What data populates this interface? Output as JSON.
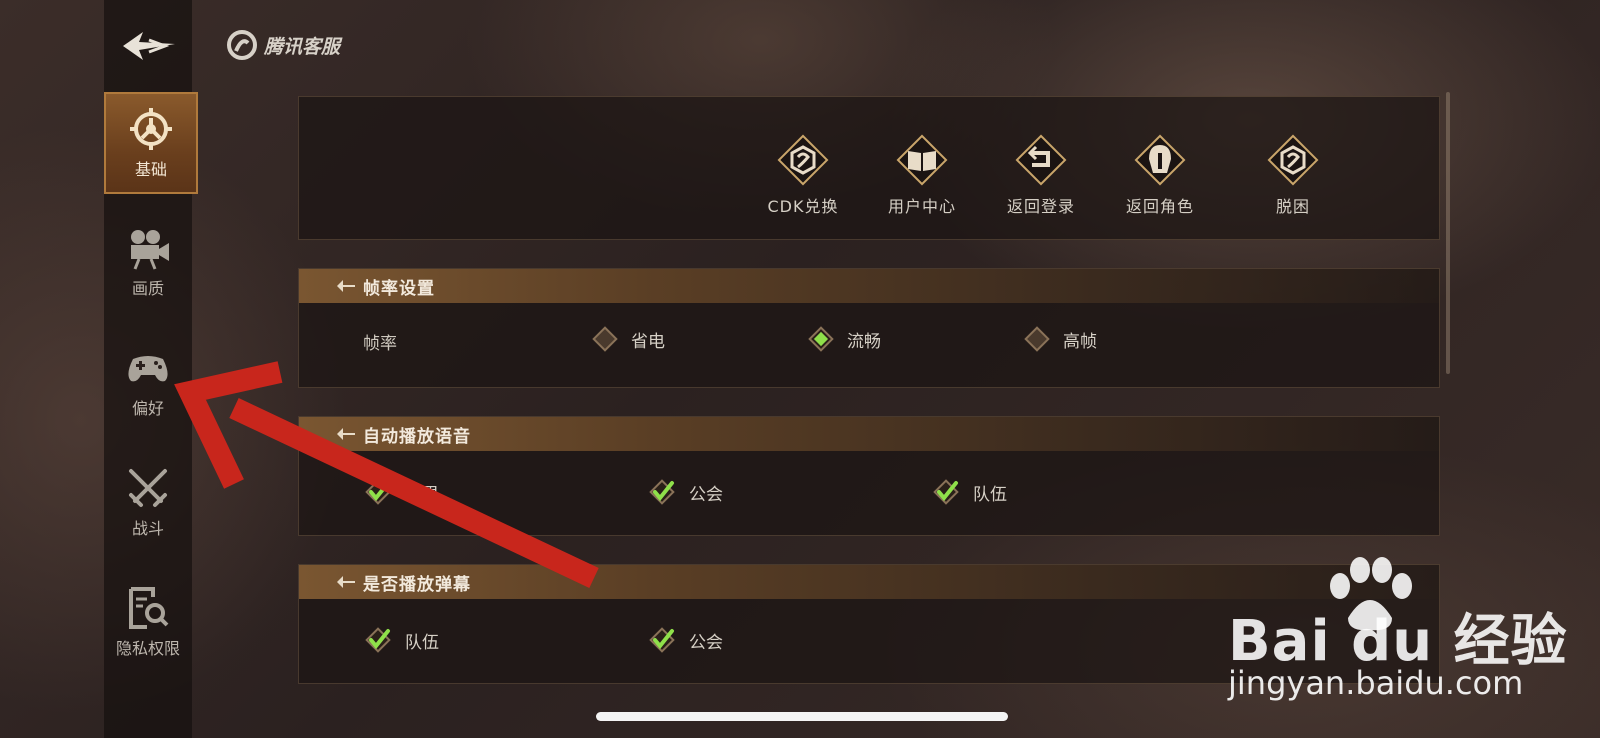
{
  "header": {
    "brand_label": "腾讯客服"
  },
  "sidebar": {
    "items": [
      {
        "label": "基础",
        "icon": "gear-wheel-icon",
        "active": true
      },
      {
        "label": "画质",
        "icon": "video-camera-icon",
        "active": false
      },
      {
        "label": "偏好",
        "icon": "gamepad-icon",
        "active": false
      },
      {
        "label": "战斗",
        "icon": "crossed-swords-icon",
        "active": false
      },
      {
        "label": "隐私权限",
        "icon": "privacy-search-icon",
        "active": false
      }
    ]
  },
  "shortcuts": [
    {
      "label": "CDK兑换",
      "icon": "cdk-badge-icon"
    },
    {
      "label": "用户中心",
      "icon": "book-icon"
    },
    {
      "label": "返回登录",
      "icon": "return-arrow-icon"
    },
    {
      "label": "返回角色",
      "icon": "helmet-icon"
    },
    {
      "label": "脱困",
      "icon": "escape-badge-icon"
    }
  ],
  "framerate": {
    "title": "帧率设置",
    "row_label": "帧率",
    "options": [
      {
        "label": "省电",
        "selected": false
      },
      {
        "label": "流畅",
        "selected": true
      },
      {
        "label": "高帧",
        "selected": false
      }
    ]
  },
  "auto_voice": {
    "title": "自动播放语音",
    "options": [
      {
        "label": "世界",
        "checked": true
      },
      {
        "label": "公会",
        "checked": true
      },
      {
        "label": "队伍",
        "checked": true
      }
    ]
  },
  "danmaku": {
    "title": "是否播放弹幕",
    "options": [
      {
        "label": "队伍",
        "checked": true
      },
      {
        "label": "公会",
        "checked": true
      }
    ]
  },
  "watermark": {
    "logo": "Bai du 经验",
    "url": "jingyan.baidu.com"
  },
  "colors": {
    "accent_green": "#8fe04a",
    "active_tab": "#7a4b22",
    "gold": "#c9a56a"
  }
}
